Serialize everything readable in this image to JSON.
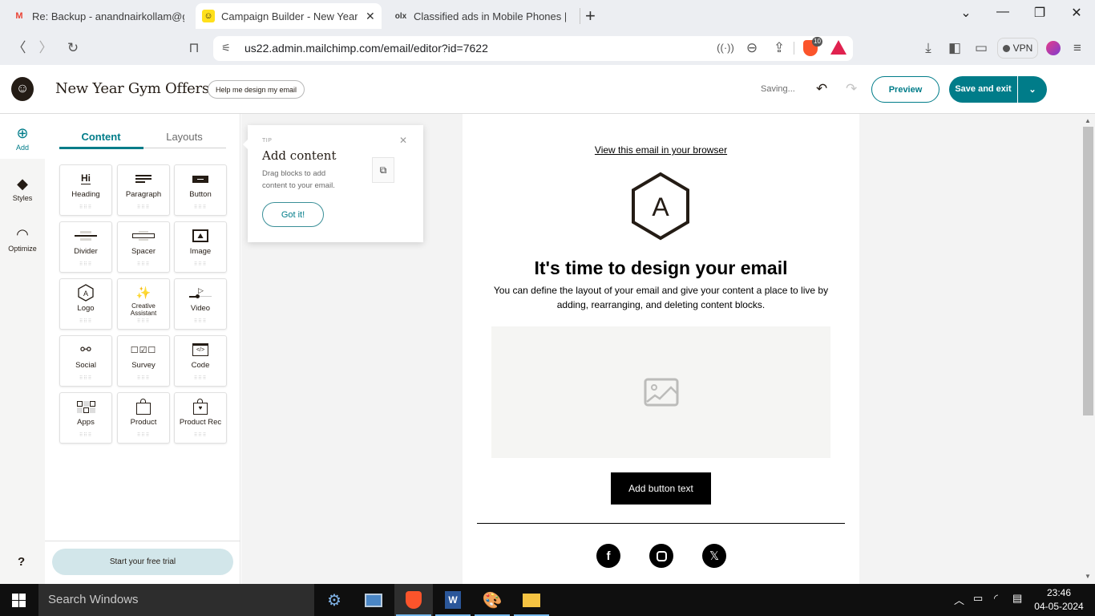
{
  "browser": {
    "tabs": [
      {
        "title": "Re: Backup - anandnairkollam@gmail",
        "favicon": "gmail-icon",
        "active": false
      },
      {
        "title": "Campaign Builder - New Year Gym",
        "favicon": "mailchimp-icon",
        "active": true
      },
      {
        "title": "Classified ads in Mobile Phones | OLX",
        "favicon": "olx-icon",
        "active": false
      }
    ],
    "new_tab_label": "+",
    "url": "us22.admin.mailchimp.com/email/editor?id=7622",
    "shields_count": "10",
    "vpn_label": "VPN"
  },
  "app": {
    "campaign_title": "New Year Gym Offers",
    "help_button": "Help me design my email",
    "status": "Saving...",
    "preview_label": "Preview",
    "save_exit_label": "Save and exit"
  },
  "rail": {
    "items": [
      {
        "label": "Add",
        "icon": "plus-circle-icon"
      },
      {
        "label": "Styles",
        "icon": "paint-bucket-icon"
      },
      {
        "label": "Optimize",
        "icon": "gauge-icon"
      }
    ],
    "help_label": "?"
  },
  "panel": {
    "tabs": [
      {
        "label": "Content",
        "active": true
      },
      {
        "label": "Layouts",
        "active": false
      }
    ],
    "blocks": [
      {
        "label": "Heading",
        "icon": "heading-icon"
      },
      {
        "label": "Paragraph",
        "icon": "paragraph-icon"
      },
      {
        "label": "Button",
        "icon": "button-icon"
      },
      {
        "label": "Divider",
        "icon": "divider-icon"
      },
      {
        "label": "Spacer",
        "icon": "spacer-icon"
      },
      {
        "label": "Image",
        "icon": "image-icon"
      },
      {
        "label": "Logo",
        "icon": "logo-icon"
      },
      {
        "label": "Creative Assistant",
        "icon": "magic-wand-icon"
      },
      {
        "label": "Video",
        "icon": "video-icon"
      },
      {
        "label": "Social",
        "icon": "share-icon"
      },
      {
        "label": "Survey",
        "icon": "survey-icon"
      },
      {
        "label": "Code",
        "icon": "code-icon"
      },
      {
        "label": "Apps",
        "icon": "apps-icon"
      },
      {
        "label": "Product",
        "icon": "shopping-bag-icon"
      },
      {
        "label": "Product Rec",
        "icon": "product-rec-icon"
      }
    ],
    "trial_button": "Start your free trial"
  },
  "tip": {
    "eyebrow": "TIP",
    "title": "Add content",
    "body": "Drag blocks to add content to your email.",
    "button": "Got it!"
  },
  "email": {
    "view_in_browser": "View this email in your browser",
    "logo_letter": "A",
    "headline": "It's time to design your email",
    "body": "You can define the layout of your email and give your content a place to live by adding, rearranging, and deleting content blocks.",
    "button_text": "Add button text",
    "social": [
      "facebook",
      "instagram",
      "x"
    ]
  },
  "taskbar": {
    "search_placeholder": "Search Windows",
    "time": "23:46",
    "date": "04-05-2024"
  }
}
